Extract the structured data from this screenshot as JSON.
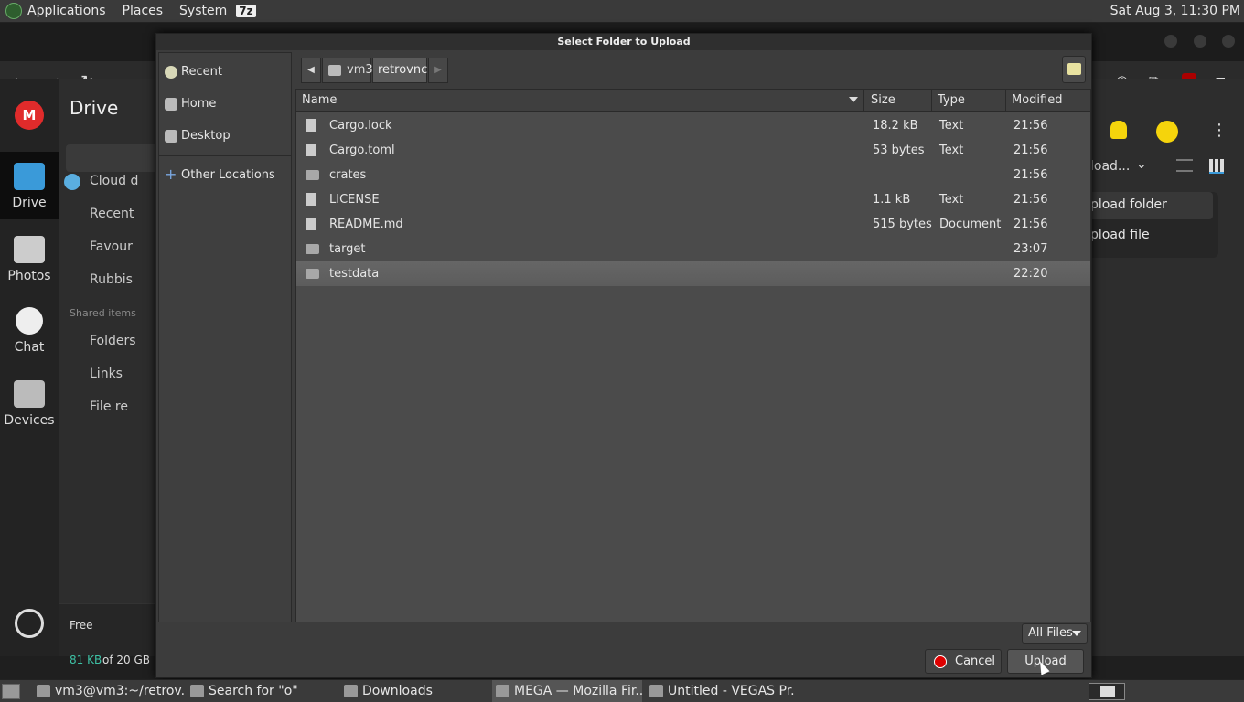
{
  "top_panel": {
    "menus": [
      "Applications",
      "Places",
      "System"
    ],
    "app_badge": "7z",
    "clock": "Sat Aug  3, 11:30 PM"
  },
  "mega": {
    "rail": {
      "logo": "M",
      "drive": "Drive",
      "photos": "Photos",
      "chat": "Chat",
      "devices": "Devices"
    },
    "drive_panel": {
      "title": "Drive",
      "cloud": "Cloud d",
      "recent": "Recent",
      "favourites": "Favour",
      "rubbish": "Rubbis",
      "shared_heading": "Shared items",
      "folders": "Folders",
      "links": "Links",
      "file_requests": "File re",
      "free_label": "Free",
      "usage_used": "81 KB",
      "usage_total": "of 20 GB"
    },
    "upload_dropdown": "load...",
    "upload_menu": [
      "pload folder",
      "pload file"
    ],
    "colors": {
      "brand": "#e02b2b",
      "usage": "#3ec1a5",
      "notify": "#f5d40c"
    }
  },
  "dialog": {
    "title": "Select Folder to Upload",
    "places": [
      "Recent",
      "Home",
      "Desktop",
      "Other Locations"
    ],
    "path": [
      "vm3",
      "retrovnc"
    ],
    "columns": {
      "name": "Name",
      "size": "Size",
      "type": "Type",
      "modified": "Modified"
    },
    "files": [
      {
        "name": "Cargo.lock",
        "size": "18.2 kB",
        "type": "Text",
        "modified": "21:56",
        "kind": "file"
      },
      {
        "name": "Cargo.toml",
        "size": "53 bytes",
        "type": "Text",
        "modified": "21:56",
        "kind": "file"
      },
      {
        "name": "crates",
        "size": "",
        "type": "",
        "modified": "21:56",
        "kind": "folder"
      },
      {
        "name": "LICENSE",
        "size": "1.1 kB",
        "type": "Text",
        "modified": "21:56",
        "kind": "file"
      },
      {
        "name": "README.md",
        "size": "515 bytes",
        "type": "Document",
        "modified": "21:56",
        "kind": "file"
      },
      {
        "name": "target",
        "size": "",
        "type": "",
        "modified": "23:07",
        "kind": "folder"
      },
      {
        "name": "testdata",
        "size": "",
        "type": "",
        "modified": "22:20",
        "kind": "folder",
        "selected": true
      }
    ],
    "filter": "All Files",
    "cancel": "Cancel",
    "upload": "Upload"
  },
  "taskbar": {
    "tasks": [
      {
        "label": "vm3@vm3:~/retrov...",
        "icon": "terminal-icon"
      },
      {
        "label": "Search for \"o\"",
        "icon": "search-icon"
      },
      {
        "label": "Downloads",
        "icon": "folder-icon"
      },
      {
        "label": "MEGA — Mozilla Fir...",
        "icon": "firefox-icon",
        "active": true
      },
      {
        "label": "Untitled - VEGAS Pr...",
        "icon": "vegas-icon"
      }
    ]
  }
}
